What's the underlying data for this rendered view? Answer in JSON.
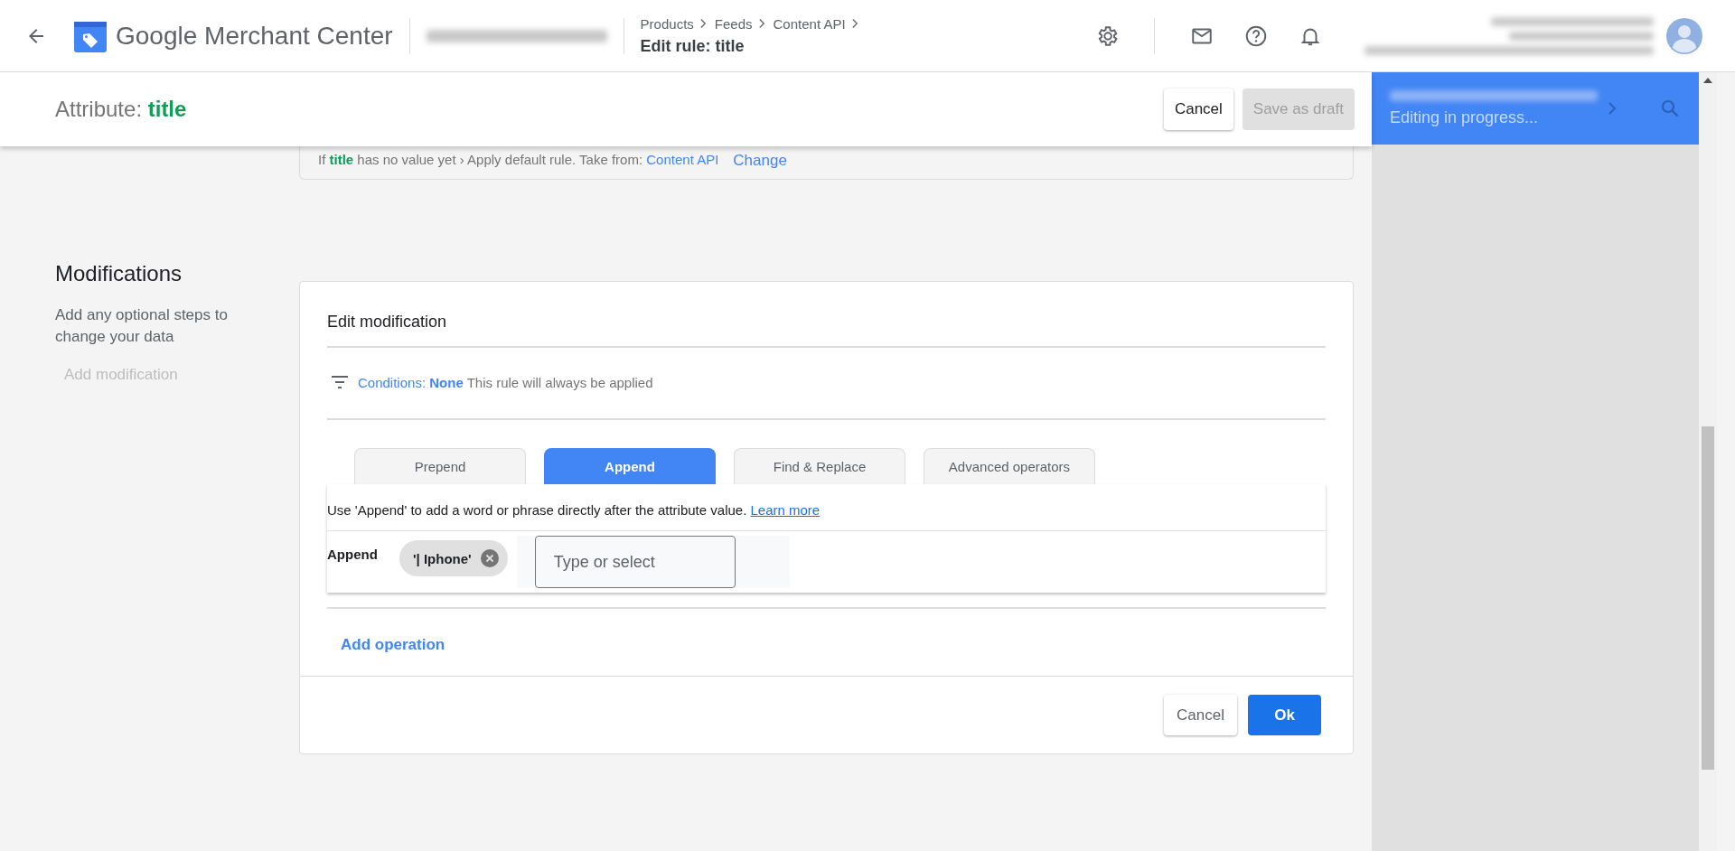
{
  "header": {
    "product": "Google Merchant Center",
    "breadcrumbs": [
      "Products",
      "Feeds",
      "Content API"
    ],
    "page_title": "Edit rule: title"
  },
  "attribute_bar": {
    "label": "Attribute:",
    "attribute": "title",
    "buttons": [
      {
        "label": "Cancel",
        "disabled": false
      },
      {
        "label": "Save as draft",
        "disabled": true
      }
    ]
  },
  "side_panel": {
    "status": "Editing in progress..."
  },
  "default_rule": {
    "text": "If **title** has no value yet › Apply default rule. Take from:",
    "source": "Content API",
    "link": "Change"
  },
  "modifications": {
    "heading": "Modifications",
    "description": "Add any optional steps to change your data",
    "add_button": {
      "label": "Add modification",
      "disabled": true
    },
    "editor": {
      "title": "Edit modification",
      "conditions": {
        "label": "Conditions:",
        "value": "None",
        "note": "This rule will always be applied"
      },
      "tabs": [
        {
          "label": "Prepend",
          "selected": false
        },
        {
          "label": "Append",
          "selected": true
        },
        {
          "label": "Find & Replace",
          "selected": false
        },
        {
          "label": "Advanced operators",
          "selected": false
        }
      ],
      "help": {
        "text": "Use 'Append' to add a word or phrase directly after the attribute value.",
        "link": "Learn more"
      },
      "operation": {
        "label": "Append",
        "chips": [
          "'| Iphone'"
        ],
        "input": {
          "placeholder": "Type or select"
        }
      },
      "add_operation": "Add operation",
      "buttons": [
        {
          "label": "Cancel",
          "kind": "secondary"
        },
        {
          "label": "Ok",
          "kind": "primary"
        }
      ]
    }
  }
}
